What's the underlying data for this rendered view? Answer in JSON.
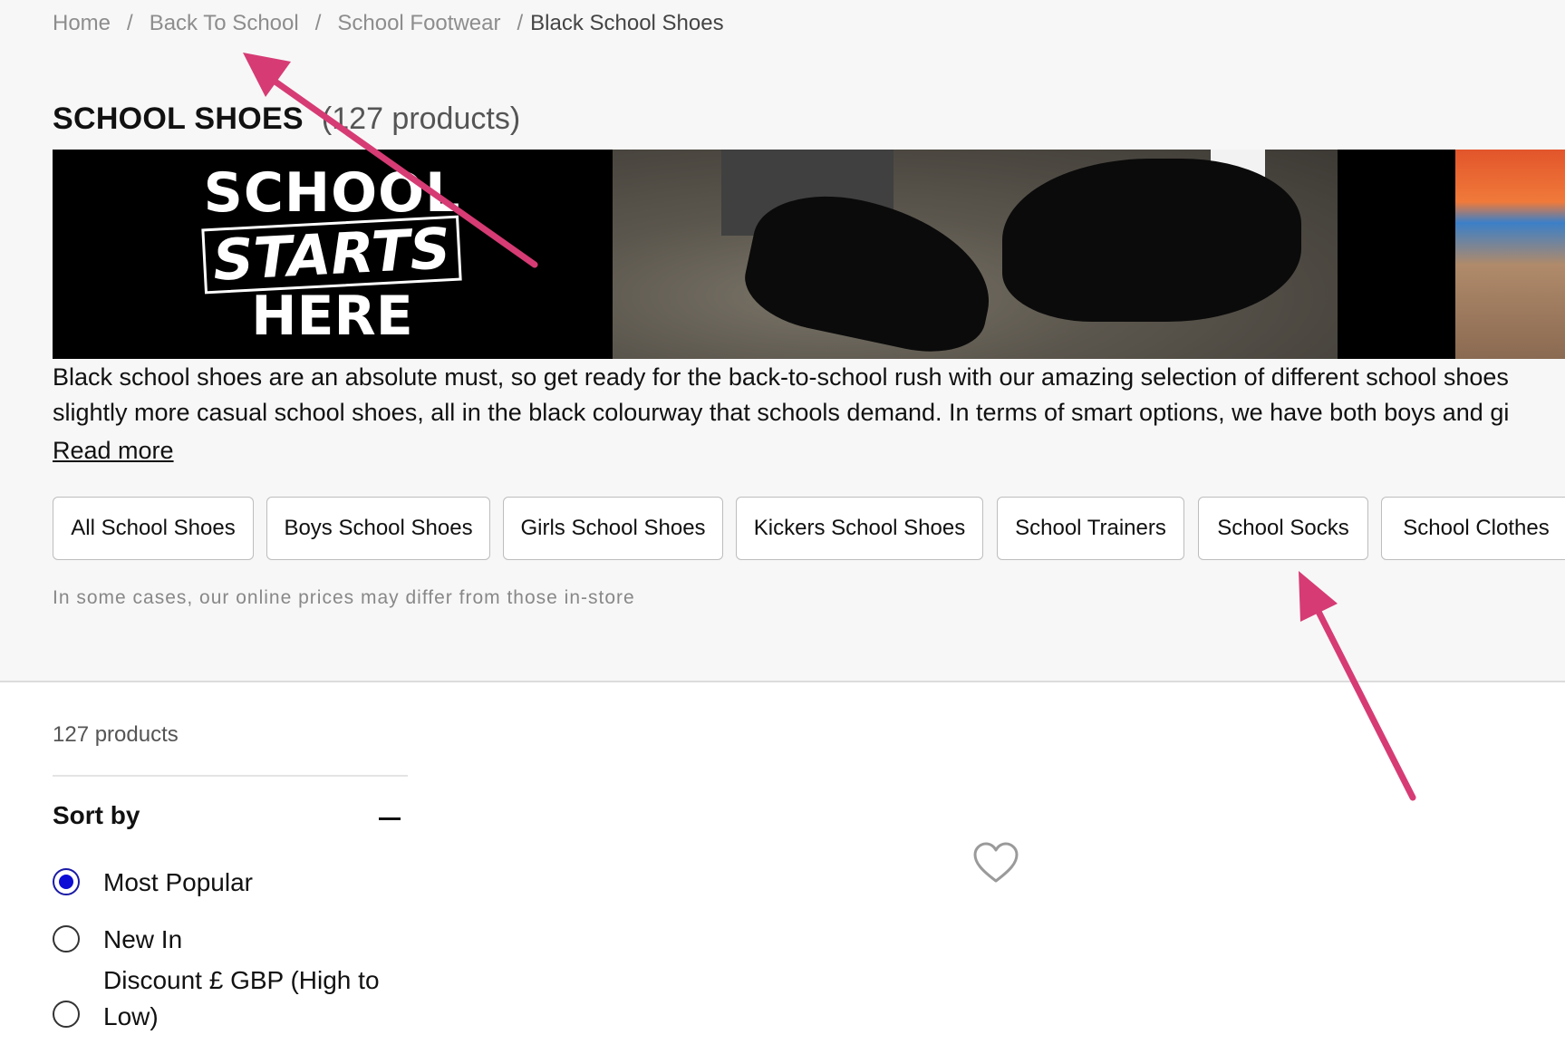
{
  "breadcrumb": {
    "items": [
      "Home",
      "Back To School",
      "School Footwear"
    ],
    "current": "Black School Shoes",
    "separator": "/"
  },
  "header": {
    "title": "SCHOOL SHOES",
    "count": "(127 products)"
  },
  "banner": {
    "line1": "SCHOOL",
    "line2": "STARTS",
    "line3": "HERE"
  },
  "description": {
    "line1": "Black school shoes are an absolute must, so get ready for the back-to-school rush with our amazing selection of different school shoes",
    "line2": "slightly more casual school shoes, all in the black colourway that schools demand. In terms of smart options, we have both boys and gi",
    "read_more": "Read more"
  },
  "chips": [
    "All School Shoes",
    "Boys School Shoes",
    "Girls School Shoes",
    "Kickers School Shoes",
    "School Trainers",
    "School Socks",
    "School Clothes"
  ],
  "price_note": "In some cases, our online prices may differ from those in-store",
  "listing": {
    "product_count": "127 products"
  },
  "sort": {
    "title": "Sort by",
    "options": [
      {
        "label": "Most Popular",
        "checked": true
      },
      {
        "label": "New In",
        "checked": false
      },
      {
        "label": "Discount £ GBP (High to Low)",
        "checked": false
      }
    ]
  },
  "colors": {
    "accent_radio": "#0d0dd6",
    "annotation_arrow": "#d63b74",
    "background_top": "#f7f7f7"
  },
  "icons": {
    "collapse": "minus-icon",
    "wishlist": "heart-outline-icon"
  }
}
